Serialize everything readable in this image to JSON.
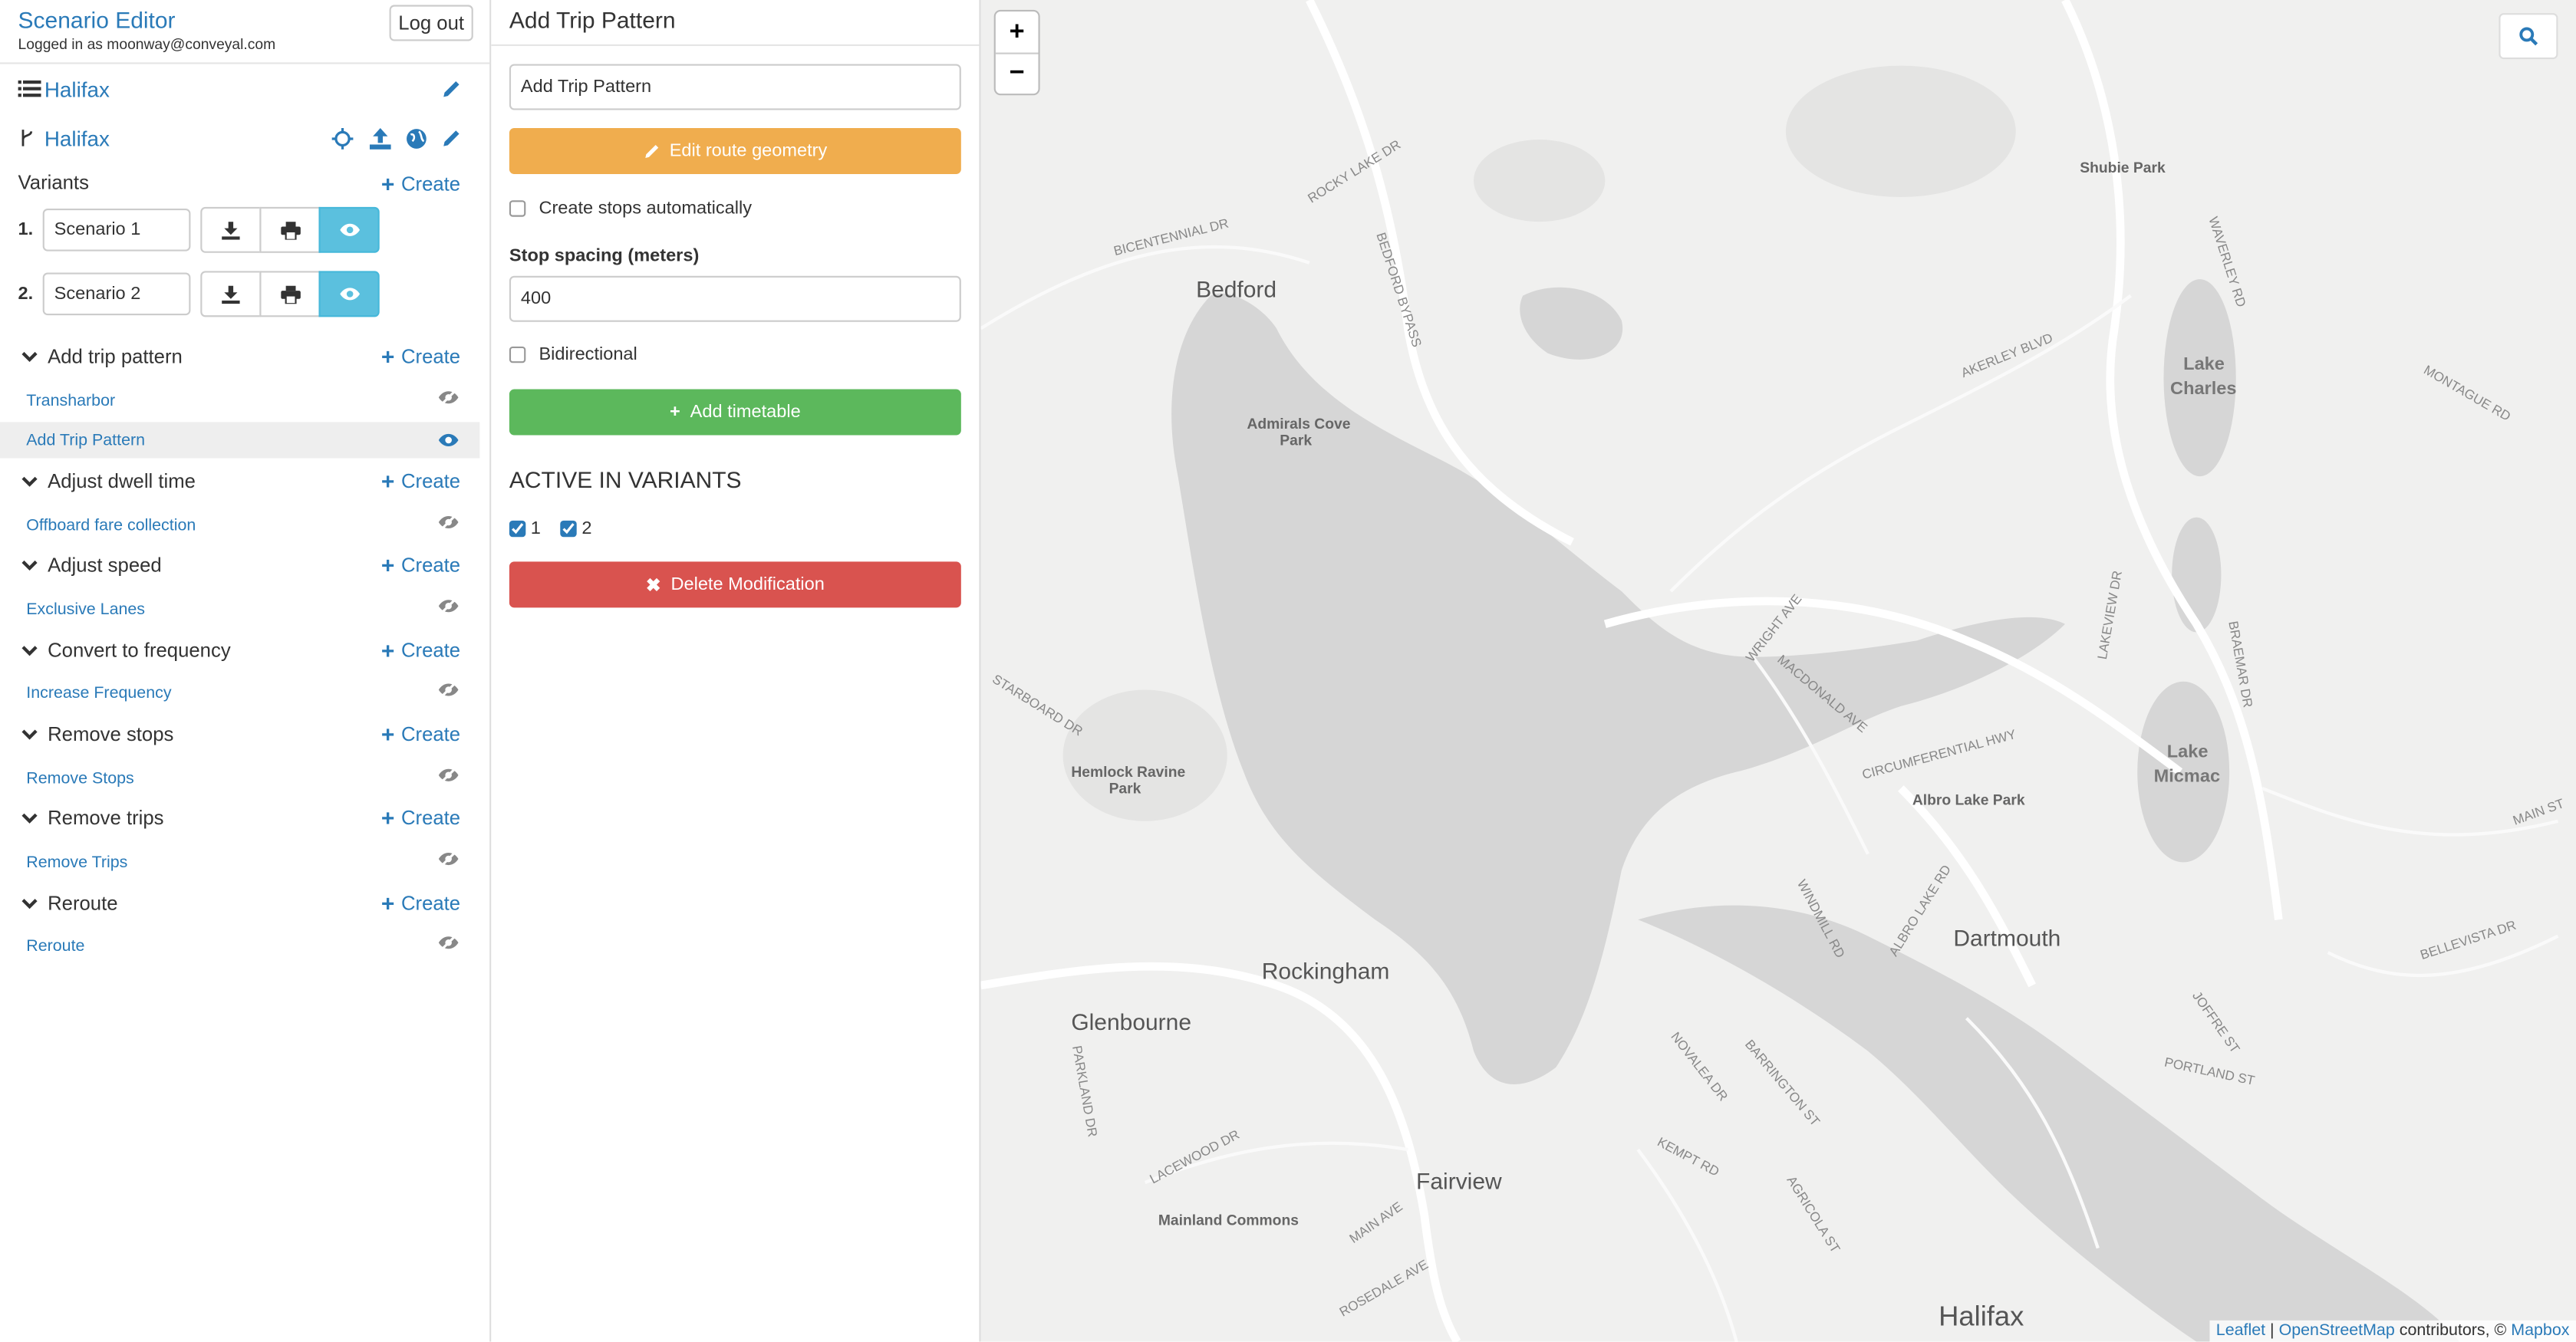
{
  "header": {
    "app_title": "Scenario Editor",
    "login_text": "Logged in as moonway@conveyal.com",
    "logout_label": "Log out"
  },
  "project": {
    "name": "Halifax"
  },
  "bundle": {
    "name": "Halifax"
  },
  "variants": {
    "label": "Variants",
    "create_label": "Create",
    "items": [
      {
        "num": "1.",
        "name": "Scenario 1"
      },
      {
        "num": "2.",
        "name": "Scenario 2"
      }
    ]
  },
  "modification_types": [
    {
      "label": "Add trip pattern",
      "create_label": "Create",
      "items": [
        "Transharbor",
        "Add Trip Pattern"
      ]
    },
    {
      "label": "Adjust dwell time",
      "create_label": "Create",
      "items": [
        "Offboard fare collection"
      ]
    },
    {
      "label": "Adjust speed",
      "create_label": "Create",
      "items": [
        "Exclusive Lanes"
      ]
    },
    {
      "label": "Convert to frequency",
      "create_label": "Create",
      "items": [
        "Increase Frequency"
      ]
    },
    {
      "label": "Remove stops",
      "create_label": "Create",
      "items": [
        "Remove Stops"
      ]
    },
    {
      "label": "Remove trips",
      "create_label": "Create",
      "items": [
        "Remove Trips"
      ]
    },
    {
      "label": "Reroute",
      "create_label": "Create",
      "items": [
        "Reroute"
      ]
    }
  ],
  "panel": {
    "title": "Add Trip Pattern",
    "name_value": "Add Trip Pattern",
    "edit_geometry_label": "Edit route geometry",
    "create_stops_label": "Create stops automatically",
    "stop_spacing_label": "Stop spacing (meters)",
    "stop_spacing_value": "400",
    "bidirectional_label": "Bidirectional",
    "add_timetable_label": "Add timetable",
    "active_heading": "ACTIVE IN VARIANTS",
    "variant_checks": [
      "1",
      "2"
    ],
    "delete_label": "Delete Modification"
  },
  "map": {
    "zoom_in": "+",
    "zoom_out": "−",
    "labels": {
      "bedford": "Bedford",
      "rockingham": "Rockingham",
      "glenbourne": "Glenbourne",
      "fairview": "Fairview",
      "halifax": "Halifax",
      "dartmouth": "Dartmouth",
      "lake_charles_1": "Lake",
      "lake_charles_2": "Charles",
      "lake_micmac_1": "Lake",
      "lake_micmac_2": "Micmac",
      "shubie": "Shubie Park",
      "admirals_1": "Admirals Cove",
      "admirals_2": "Park",
      "hemlock_1": "Hemlock Ravine",
      "hemlock_2": "Park",
      "albro": "Albro Lake Park",
      "mainland": "Mainland Commons",
      "rocky_lake": "ROCKY LAKE DR",
      "bicentennial": "BICENTENNIAL DR",
      "bedford_bypass": "BEDFORD BYPASS",
      "akerley": "AKERLEY BLVD",
      "circumferential": "CIRCUMFERENTIAL HWY",
      "wright": "WRIGHT AVE",
      "macdonald": "MACDONALD AVE",
      "albro_rd": "ALBRO LAKE RD",
      "windmill": "WINDMILL RD",
      "lacewood": "LACEWOOD DR",
      "main_ave": "MAIN AVE",
      "portland": "PORTLAND ST",
      "bellevista": "BELLEVISTA DR",
      "montague": "MONTAGUE RD",
      "main_st": "MAIN ST",
      "kempt": "KEMPT RD",
      "barrington": "BARRINGTON ST",
      "agricola": "AGRICOLA ST",
      "novalea": "NOVALEA DR",
      "joffre": "JOFFRE ST",
      "braemar": "BRAEMAR DR",
      "lakeview": "LAKEVIEW DR",
      "waverley": "WAVERLEY RD",
      "parkland": "PARKLAND DR",
      "rosedale": "ROSEDALE AVE",
      "starboard": "STARBOARD DR"
    },
    "attribution": {
      "leaflet": "Leaflet",
      "sep1": " | ",
      "osm": "OpenStreetMap",
      "contrib": " contributors, © ",
      "mapbox": "Mapbox"
    }
  }
}
